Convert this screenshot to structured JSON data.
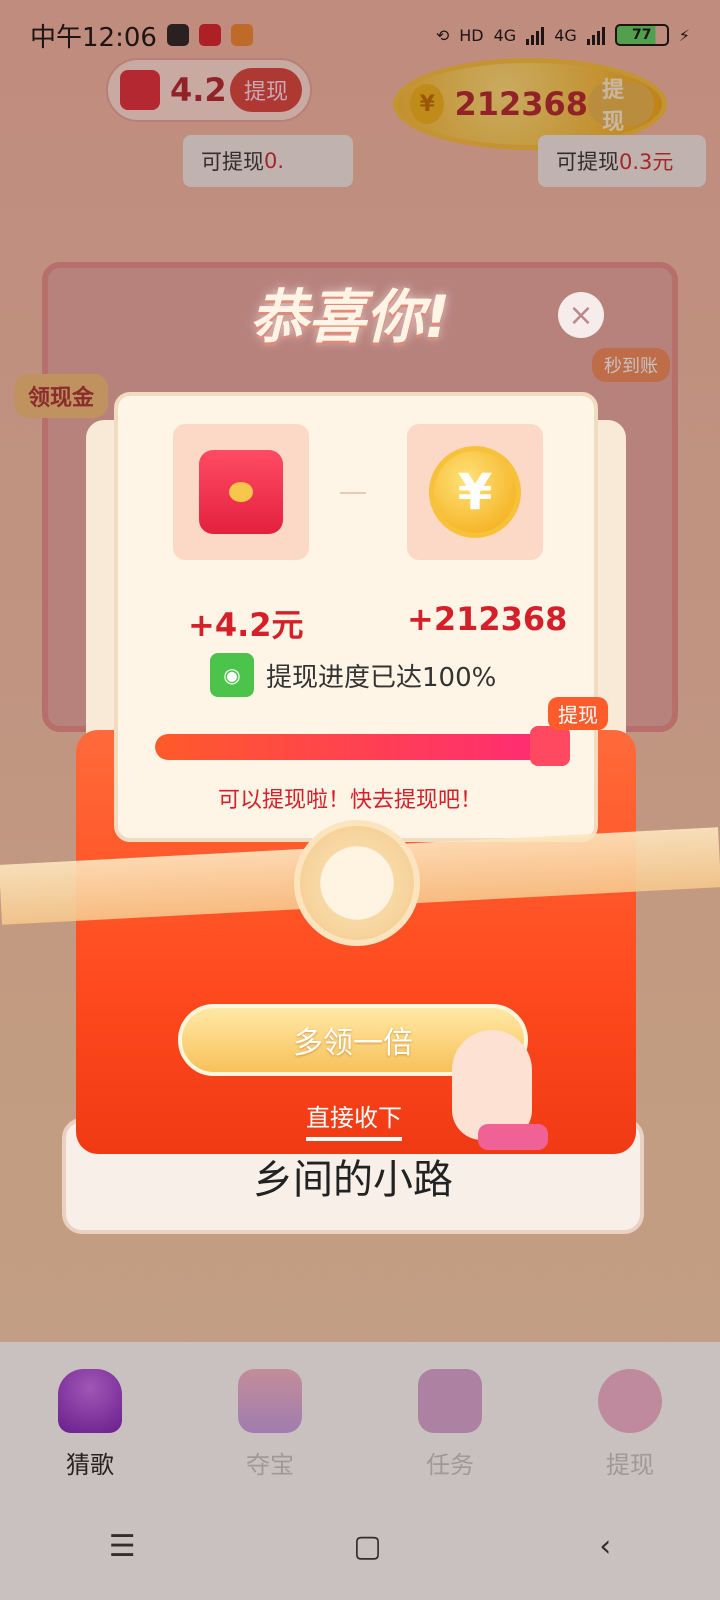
{
  "status_bar": {
    "time": "中午12:06",
    "network_1": "4G",
    "network_2": "4G",
    "hd": "HD",
    "battery": "77"
  },
  "top": {
    "cash_amount": "4.2",
    "cash_withdraw": "提现",
    "coin_symbol": "¥",
    "coin_amount": "212368",
    "coin_withdraw": "提现",
    "tip_left_prefix": "可提现",
    "tip_left_value": "0.",
    "tip_right_prefix": "可提现",
    "tip_right_value": "0.3元"
  },
  "background": {
    "side_badge": "领现金",
    "right_badge": "秒到账",
    "song_title": "乡间的小路"
  },
  "modal": {
    "title": "恭喜你!",
    "close": "×",
    "coin_symbol": "¥",
    "cash_reward": "+4.2元",
    "coin_reward": "+212368",
    "progress_text": "提现进度已达100%",
    "progress_percent": 100,
    "progress_tag": "提现",
    "hint": "可以提现啦！快去提现吧！",
    "double_button": "多领一倍",
    "direct_link": "直接收下"
  },
  "bottom_nav": {
    "items": [
      {
        "label": "猜歌",
        "icon": "microphone-icon",
        "active": true
      },
      {
        "label": "夺宝",
        "icon": "gift-box-icon",
        "active": false
      },
      {
        "label": "任务",
        "icon": "clipboard-icon",
        "active": false
      },
      {
        "label": "提现",
        "icon": "piggy-bank-icon",
        "active": false
      }
    ]
  },
  "system_nav": {
    "menu": "☰",
    "home": "▢",
    "back": "‹"
  },
  "colors": {
    "accent_red": "#d5202a",
    "envelope_orange": "#ff4a1f",
    "coin_gold": "#f2a70e",
    "wechat_green": "#4cc34a"
  }
}
